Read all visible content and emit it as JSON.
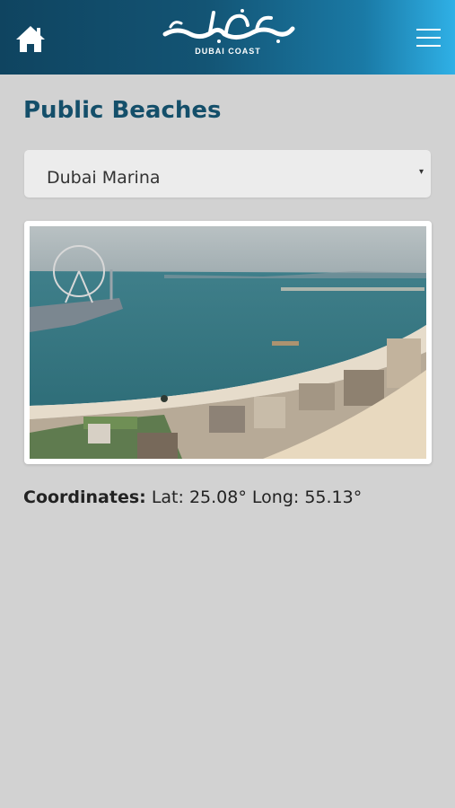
{
  "header": {
    "logo_subtitle": "DUBAI COAST",
    "home_icon": "home-icon",
    "menu_icon": "hamburger-menu-icon",
    "colors": {
      "gradient_start": "#0f4460",
      "gradient_end": "#2fb0e6"
    }
  },
  "page": {
    "title": "Public Beaches",
    "title_color": "#144f6a"
  },
  "beach_select": {
    "selected": "Dubai Marina",
    "caret": "▾"
  },
  "coordinates": {
    "label": "Coordinates:",
    "lat_label": "Lat:",
    "lat_value": "25.08°",
    "long_label": "Long:",
    "long_value": "55.13°"
  }
}
